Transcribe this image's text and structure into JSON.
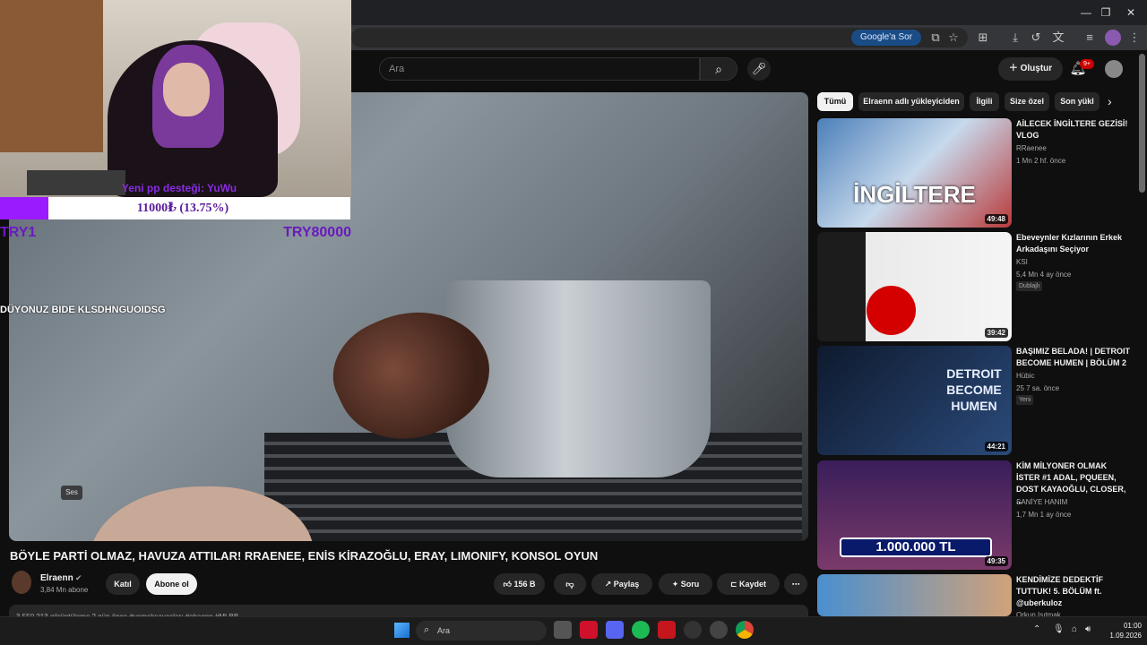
{
  "browser": {
    "google_ask": "Google'a Sor",
    "window_controls": [
      "minimize-icon",
      "maximize-icon",
      "close-icon"
    ]
  },
  "youtube": {
    "search_placeholder": "Ara",
    "create_label": "Oluştur",
    "notification_count": "9+"
  },
  "stream_overlay": {
    "donate_label": "Yeni pp desteği: YuWu",
    "goal_text": "11000₺ (13.75%)",
    "goal_progress_fraction": 0.1375,
    "goal_left": "TRY1",
    "goal_right": "TRY80000",
    "chat_ticker": "DÜYONUZ BIDE KLSDHNGUOIDSG"
  },
  "video": {
    "ses_label": "Ses",
    "title": "BÖYLE PARTİ OLMAZ, HAVUZA ATTILAR! RRAENEE, ENİS KİRAZOĞLU, ERAY, LIMONIFY, KONSOL OYUN",
    "channel_name": "Elraenn",
    "channel_subs": "3,84 Mn abone",
    "join_label": "Katıl",
    "subscribe_label": "Abone ol",
    "like_count": "156 B",
    "share_label": "Paylaş",
    "ask_label": "Soru",
    "save_label": "Kaydet",
    "description_line": "3.550.213 görüntüleme  2 gün önce  #yemeksavaşları #elraenn #MLBB"
  },
  "sidebar": {
    "chips": [
      "Tümü",
      "Elraenn adlı yükleyiciden",
      "İlgili",
      "Size özel",
      "Son yükl"
    ],
    "recommendations": [
      {
        "title": "AİLECEK İNGİLTERE GEZİSİ! VLOG",
        "channel": "RRaenee",
        "meta": "1 Mn  2 hf. önce",
        "duration": "49:48",
        "badge": "",
        "thumb_text": "İNGİLTERE"
      },
      {
        "title": "Ebeveynler Kızlarının Erkek Arkadaşını Seçiyor",
        "channel": "KSI",
        "meta": "5,4 Mn  4 ay önce",
        "duration": "39:42",
        "badge": "Dublajlı",
        "thumb_text": ""
      },
      {
        "title": "BAŞIMIZ BELADA! | DETROIT BECOME HUMEN | BÖLÜM 2",
        "channel": "Hübic",
        "meta": "25  7 sa. önce",
        "duration": "44:21",
        "badge": "Yeni",
        "thumb_text": "DETROIT BECOME HUMEN"
      },
      {
        "title": "KİM MİLYONER OLMAK İSTER #1 ADAL, PQUEEN, DOST KAYAOĞLU, CLOSER, ...",
        "channel": "SANİYE HANIM",
        "meta": "1,7 Mn  1 ay önce",
        "duration": "49:35",
        "badge": "",
        "thumb_text": "1.000.000 TL"
      },
      {
        "title": "KENDİMİZE DEDEKTİF TUTTUK! 5. BÖLÜM ft. @uberkuloz",
        "channel": "Orkun Işıtmak",
        "meta": "",
        "duration": "",
        "badge": "",
        "thumb_text": ""
      }
    ]
  },
  "taskbar": {
    "search_placeholder": "Ara",
    "time": "01:00",
    "date": "1.09.2026"
  }
}
